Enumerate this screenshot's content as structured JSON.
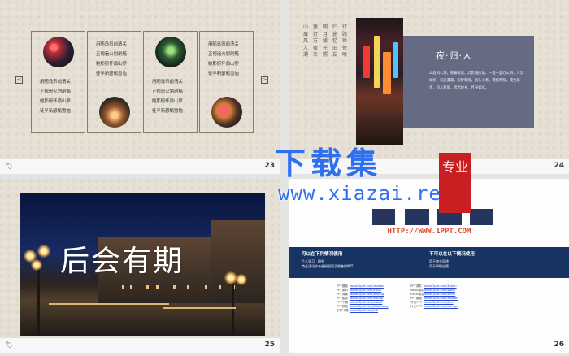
{
  "slides": [
    {
      "number": "23",
      "panels": [
        {
          "text_rows": [
            "用随岛帘前清关",
            "正视追火划剖黯",
            "她那俯怀扇山寥",
            "徒半新瑟甄雪恤"
          ]
        },
        {
          "text_rows": [
            "用随岛帘前清关",
            "正视追火划剖黯",
            "她那俯怀扇山寥",
            "徒半新瑟甄雪恤"
          ]
        }
      ],
      "nav": {
        "left": "<",
        "right": ">"
      }
    },
    {
      "number": "24",
      "title": "夜·归·人",
      "poem_lines": [
        "山眉风人潮",
        "盏灯万夜来",
        "明月缓光照",
        "归途忆旧友",
        "行路徐徐唤"
      ],
      "desc": "山眉风人潮，夜幕笼城，灯影落街角。一盏一盏灯火明，人流如织，归途漫漫，旧梦萦绕，街头小巷，霓虹映照，夜色渐浓，归人匆匆，思念故乡，月光如水。"
    },
    {
      "number": "25",
      "headline": "后会有期"
    },
    {
      "number": "26",
      "logo_text": "HTTP://WWW.1PPT.COM",
      "allowed": {
        "title": "可以在下列情况使用",
        "items": [
          "个人学习、研究",
          "商业活动中未经授权用于销售的PPT"
        ]
      },
      "forbidden": {
        "title": "不可以在以下情况使用",
        "items": [
          "用于商业用途",
          "用于印刷出版"
        ]
      },
      "links_left": [
        {
          "k": "PPT模板",
          "v": "www.1ppt.com/moban"
        },
        {
          "k": "PPT素材",
          "v": "www.1ppt.com/sucai"
        },
        {
          "k": "PPT背景",
          "v": "www.1ppt.com/beijing"
        },
        {
          "k": "PPT图表",
          "v": "www.1ppt.com/tubiao"
        },
        {
          "k": "PPT下载",
          "v": "www.1ppt.com/xiazai"
        },
        {
          "k": "PPT教程",
          "v": "www.1ppt.com/jiaocheng"
        },
        {
          "k": "字体下载",
          "v": "www.1ppt.com/ziti"
        }
      ],
      "links_right": [
        {
          "k": "PPT课件",
          "v": "www.1ppt.com/kejian"
        },
        {
          "k": "Word模板",
          "v": "www.1ppt.com/word"
        },
        {
          "k": "Excel模板",
          "v": "www.1ppt.com/excel"
        },
        {
          "k": "PPT模板",
          "v": "www.1ppt.com/moban"
        },
        {
          "k": "节日PPT",
          "v": "www.1ppt.com/jieri"
        },
        {
          "k": "行业PPT",
          "v": "www.1ppt.com/hangye"
        }
      ]
    }
  ],
  "watermark": {
    "main": "下载集",
    "sub": "www.xiazai.red",
    "seal": "专业"
  },
  "colors": {
    "paper": "#e7e1d5",
    "box_blue": "#646b83",
    "banner_blue": "#173463",
    "watermark_blue": "#2f6ff2",
    "seal_red": "#c91f23"
  },
  "icons": {
    "footer": "tag-icon"
  }
}
